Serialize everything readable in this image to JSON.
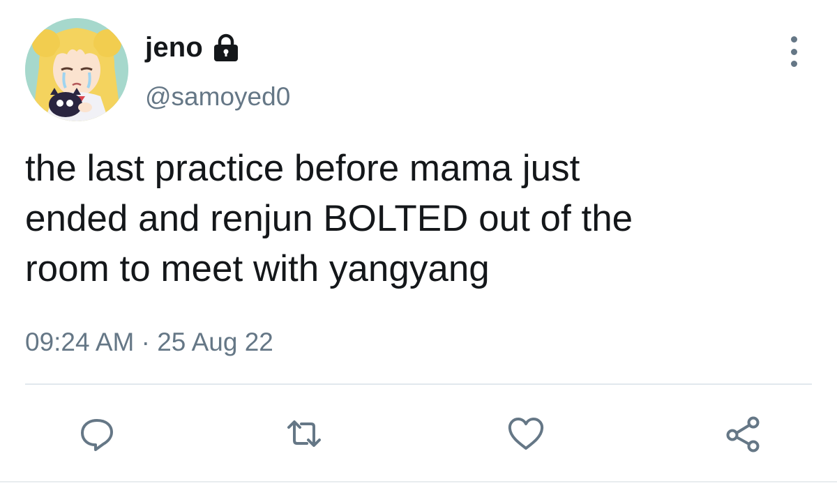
{
  "user": {
    "display_name": "jeno",
    "handle": "@samoyed0",
    "avatar_icon": "sailor-moon-crying-avatar",
    "protected_icon": "lock-icon"
  },
  "tweet": {
    "text": "the last practice before mama just\nended and renjun BOLTED out of the\nroom to meet with yangyang",
    "timestamp": "09:24 AM · 25 Aug 22"
  },
  "actions": [
    {
      "name": "reply",
      "icon": "reply-icon"
    },
    {
      "name": "retweet",
      "icon": "retweet-icon"
    },
    {
      "name": "like",
      "icon": "heart-icon"
    },
    {
      "name": "share",
      "icon": "share-icon"
    }
  ],
  "colors": {
    "text": "#14171a",
    "secondary": "#657786",
    "divider": "#e1e8ed"
  }
}
